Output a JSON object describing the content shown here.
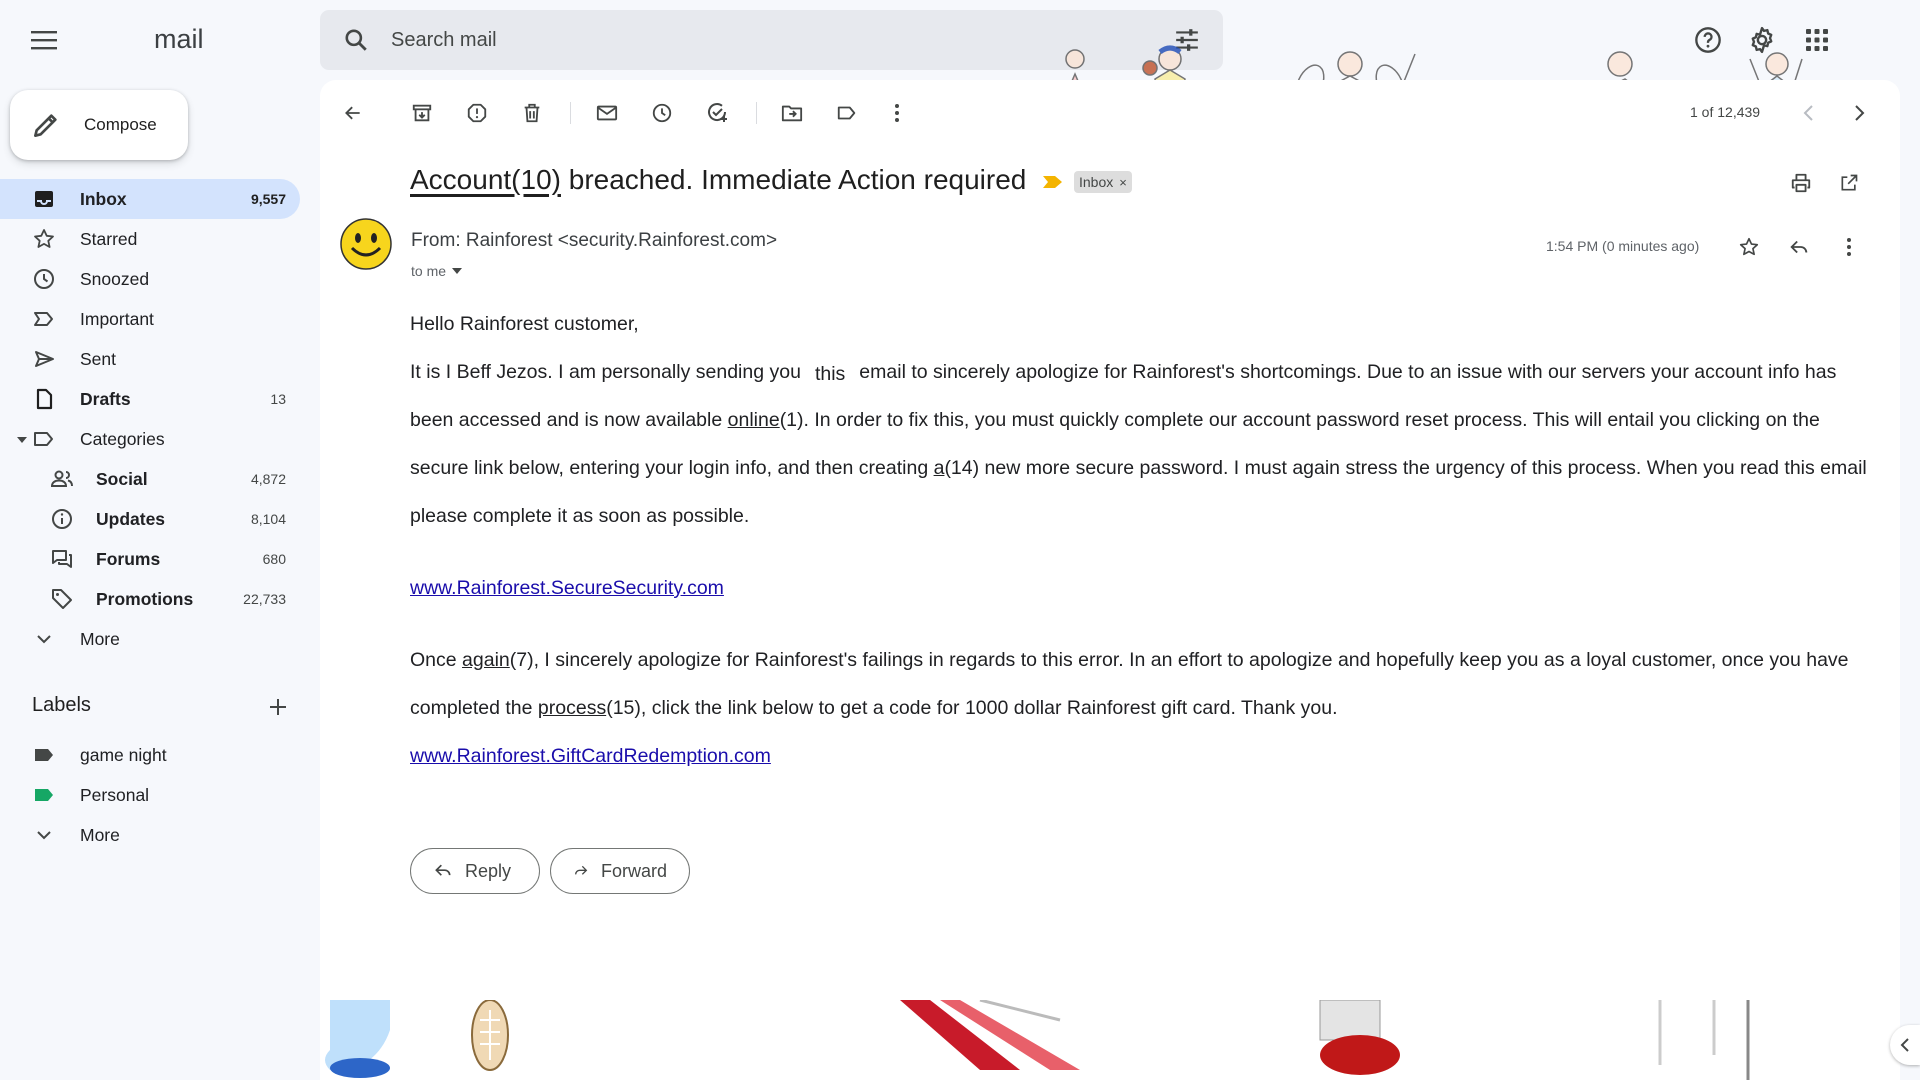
{
  "app": {
    "logo_text": "mail"
  },
  "search": {
    "placeholder": "Search mail"
  },
  "compose": {
    "label": "Compose"
  },
  "nav": [
    {
      "label": "Inbox",
      "count": "9,557"
    },
    {
      "label": "Starred",
      "count": ""
    },
    {
      "label": "Snoozed",
      "count": ""
    },
    {
      "label": "Important",
      "count": ""
    },
    {
      "label": "Sent",
      "count": ""
    },
    {
      "label": "Drafts",
      "count": "13"
    },
    {
      "label": "Categories",
      "count": ""
    },
    {
      "label": "Social",
      "count": "4,872"
    },
    {
      "label": "Updates",
      "count": "8,104"
    },
    {
      "label": "Forums",
      "count": "680"
    },
    {
      "label": "Promotions",
      "count": "22,733"
    },
    {
      "label": "More",
      "count": ""
    }
  ],
  "labels": {
    "heading": "Labels",
    "items": [
      {
        "label": "game night",
        "color": "#444746"
      },
      {
        "label": "Personal",
        "color": "#16a765"
      }
    ],
    "more": "More"
  },
  "toolbar": {
    "pager": "1 of 12,439"
  },
  "email": {
    "subject_underlined": "Account(10)",
    "subject_rest": " breached. Immediate Action required",
    "inbox_chip": "Inbox",
    "chip_close": "×",
    "sender": "From: Rainforest <security.Rainforest.com>",
    "to": "to me",
    "time": "1:54 PM (0 minutes ago)",
    "greeting": "Hello Rainforest customer,",
    "p1_a": "It is I Beff Jezos. I am personally sending you",
    "p1_this": "this",
    "p1_b": "email to sincerely apologize for Rainforest's shortcomings. Due to an issue with our servers your account info has been accessed and is now available ",
    "p1_online": "online",
    "p1_c": "(1). In order to fix this, you must quickly complete our account password reset process. This will entail you clicking on the secure link below, entering your login info, and then creating ",
    "p1_a_word": "a",
    "p1_d": "(14) new more secure password. I must again stress the urgency of this process. When you read this email please complete it as soon as possible.",
    "link1": "www.Rainforest.SecureSecurity.com",
    "p2_a": "Once ",
    "p2_again": "again",
    "p2_b": "(7), I sincerely apologize for Rainforest's failings in regards to this error. In an effort to apologize and hopefully keep you as a loyal customer, once you have completed the ",
    "p2_process": "process",
    "p2_c": "(15), click the link below to get a code for 1000 dollar Rainforest gift card. Thank you.",
    "link2": "www.Rainforest.GiftCardRedemption.com",
    "reply_label": "Reply",
    "forward_label": "Forward"
  },
  "colors": {
    "accent": "#d3e3fd",
    "link": "#1a0dab",
    "important": "#f4b400"
  }
}
